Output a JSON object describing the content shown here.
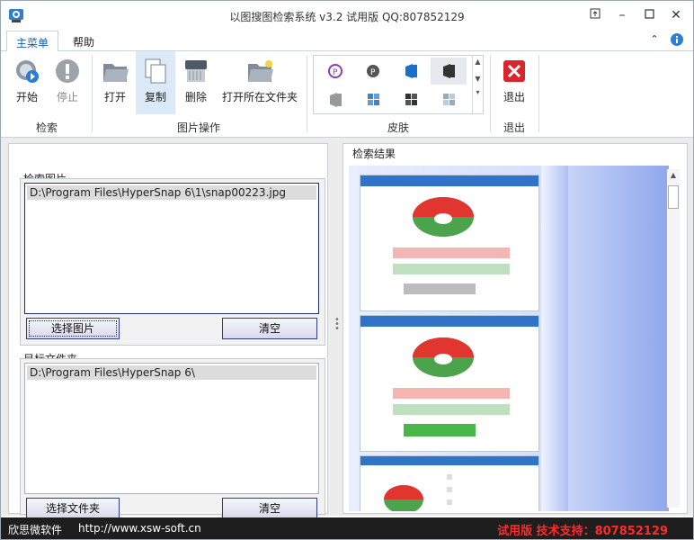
{
  "window": {
    "title": "以图搜图检索系统 v3.2 试用版    QQ:807852129",
    "controls": [
      "restore",
      "minimize",
      "maximize",
      "close"
    ]
  },
  "tabs": [
    {
      "label": "主菜单",
      "active": true
    },
    {
      "label": "帮助",
      "active": false
    }
  ],
  "ribbon": {
    "search_group": {
      "label": "检索",
      "start": "开始",
      "stop": "停止"
    },
    "image_ops_group": {
      "label": "图片操作",
      "open": "打开",
      "copy": "复制",
      "delete": "删除",
      "open_folder": "打开所在文件夹"
    },
    "skin_group": {
      "label": "皮肤"
    },
    "exit_group": {
      "label": "退出",
      "exit": "退出"
    }
  },
  "search_image": {
    "label": "检索图片",
    "path": "D:\\Program Files\\HyperSnap 6\\1\\snap00223.jpg",
    "select_button": "选择图片",
    "clear_button": "清空"
  },
  "target_folder": {
    "label": "目标文件夹",
    "path": "D:\\Program Files\\HyperSnap 6\\",
    "select_button": "选择文件夹",
    "clear_button": "清空"
  },
  "results": {
    "label": "检索结果"
  },
  "status": {
    "company": "欣思微软件",
    "url": "http://www.xsw-soft.cn",
    "trial": "试用版 技术支持：807852129"
  },
  "colors": {
    "accent": "#1b5ca8",
    "trial_red": "#ff2b2b",
    "statusbar_bg": "#1e1e1e"
  }
}
